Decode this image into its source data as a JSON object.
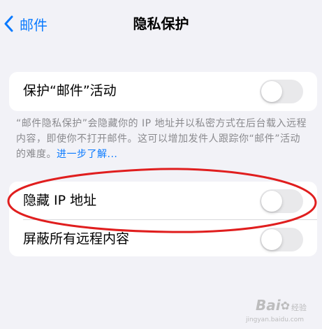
{
  "nav": {
    "back_label": "邮件",
    "title": "隐私保护"
  },
  "protect": {
    "label": "保护“邮件”活动",
    "toggle_on": false,
    "footer_text": "“邮件隐私保护”会隐藏你的 IP 地址并以私密方式在后台载入远程内容，即使你不打开邮件。这可以增加发件人跟踪你“邮件”活动的难度。",
    "learn_more": "进一步了解..."
  },
  "settings": {
    "hide_ip_label": "隐藏 IP 地址",
    "hide_ip_on": false,
    "block_remote_label": "屏蔽所有远程内容",
    "block_remote_on": false
  },
  "colors": {
    "accent": "#0a7aff",
    "annotation": "#e01e1e",
    "background": "#f2f2f7"
  },
  "watermark": {
    "main": "Bai",
    "sub": "经验",
    "url": "jingyan.baidu.com"
  }
}
